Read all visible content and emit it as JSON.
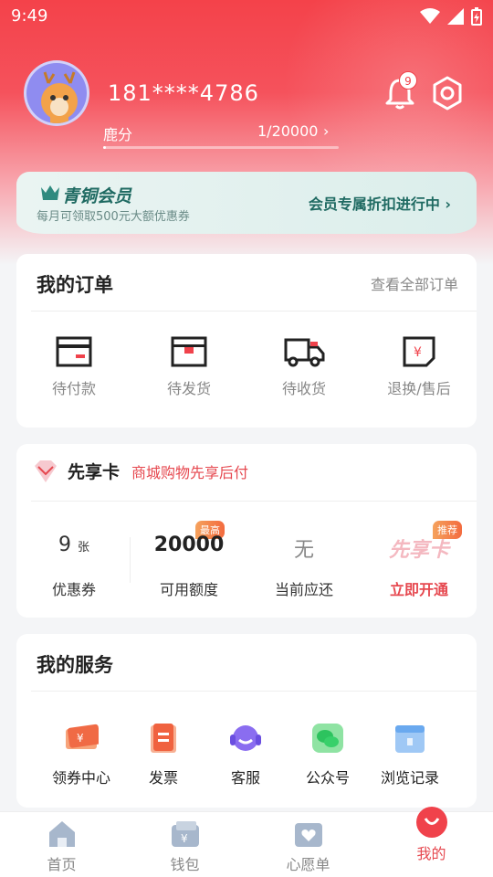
{
  "status_bar": {
    "time": "9:49"
  },
  "profile": {
    "phone": "181****4786",
    "points_label": "鹿分",
    "points_value": "1/20000",
    "points_progress": 5e-05,
    "notifications": "9"
  },
  "member_banner": {
    "title": "青铜会员",
    "subtitle": "每月可领取500元大额优惠券",
    "link": "会员专属折扣进行中"
  },
  "orders": {
    "title": "我的订单",
    "view_all": "查看全部订单",
    "items": [
      {
        "icon": "pending-payment-icon",
        "label": "待付款"
      },
      {
        "icon": "pending-shipment-icon",
        "label": "待发货"
      },
      {
        "icon": "pending-receipt-icon",
        "label": "待收货"
      },
      {
        "icon": "return-aftersale-icon",
        "label": "退换/售后"
      }
    ]
  },
  "xianxiangka": {
    "title": "先享卡",
    "subtitle": "商城购物先享后付",
    "coupons_value": "9",
    "coupons_unit": "张",
    "coupons_label": "优惠券",
    "credit_tag": "最高",
    "credit_value": "20000",
    "credit_label": "可用额度",
    "due_value": "无",
    "due_label": "当前应还",
    "promo_tag": "推荐",
    "promo_logo": "先享卡",
    "promo_label": "立即开通"
  },
  "services": {
    "title": "我的服务",
    "items": [
      {
        "icon": "coupon-center-icon",
        "label": "领券中心"
      },
      {
        "icon": "invoice-icon",
        "label": "发票"
      },
      {
        "icon": "customer-service-icon",
        "label": "客服"
      },
      {
        "icon": "wechat-official-icon",
        "label": "公众号"
      },
      {
        "icon": "browse-history-icon",
        "label": "浏览记录"
      }
    ]
  },
  "tabbar": {
    "items": [
      {
        "label": "首页"
      },
      {
        "label": "钱包"
      },
      {
        "label": "心愿单"
      },
      {
        "label": "我的"
      }
    ]
  },
  "colors": {
    "brand_red": "#f0424b",
    "member_teal": "#1f6a62"
  }
}
